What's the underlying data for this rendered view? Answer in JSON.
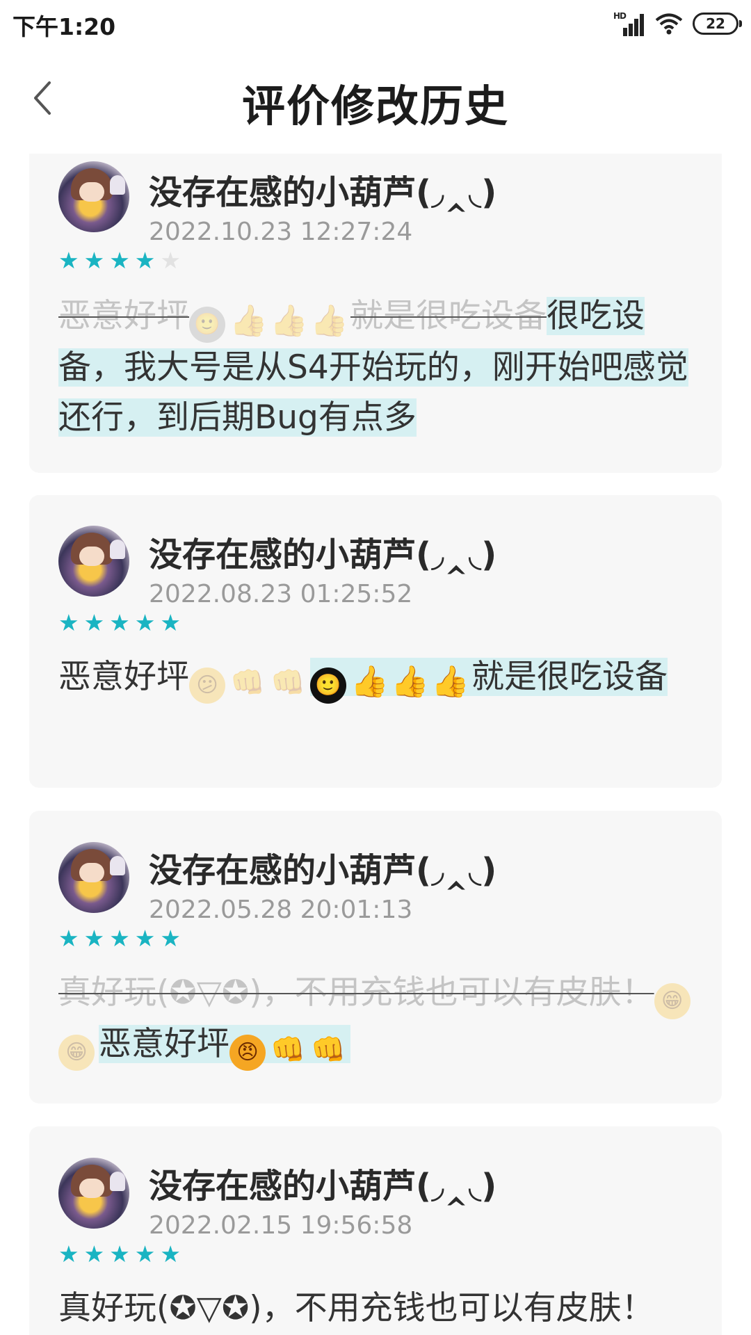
{
  "status_bar": {
    "time": "下午1:20",
    "network": "HD",
    "battery": "22"
  },
  "header": {
    "title": "评价修改历史",
    "back_icon": "chevron-left-icon"
  },
  "reviews": [
    {
      "username": "没存在感的小葫芦(◞‸◟)",
      "timestamp": "2022.10.23 12:27:24",
      "rating": 4,
      "deleted_text": "恶意好坪",
      "deleted_emojis": [
        "🙂",
        "👍",
        "👍",
        "👍"
      ],
      "deleted_text_2": "就是很吃设备",
      "added_text": "很吃设备，我大号是从S4开始玩的，刚开始吧感觉还行，到后期Bug有点多"
    },
    {
      "username": "没存在感的小葫芦(◞‸◟)",
      "timestamp": "2022.08.23 01:25:52",
      "rating": 5,
      "plain_text": "恶意好坪",
      "deleted_emojis": [
        "😕",
        "👊",
        "👊"
      ],
      "added_emojis": [
        "🙂",
        "👍",
        "👍",
        "👍"
      ],
      "added_text": "就是很吃设备"
    },
    {
      "username": "没存在感的小葫芦(◞‸◟)",
      "timestamp": "2022.05.28 20:01:13",
      "rating": 5,
      "deleted_text": "真好玩(✪▽✪)，不用充钱也可以有皮肤！",
      "deleted_emojis": [
        "😁",
        "😁"
      ],
      "added_text": "恶意好坪",
      "added_emojis": [
        "😠",
        "👊",
        "👊"
      ]
    },
    {
      "username": "没存在感的小葫芦(◞‸◟)",
      "timestamp": "2022.02.15 19:56:58",
      "rating": 5,
      "plain_text": "真好玩(✪▽✪)，不用充钱也可以有皮肤！"
    }
  ],
  "colors": {
    "star": "#1ab4c2",
    "added_bg": "#d6f0f2",
    "deleted_text": "#c4c4c4",
    "card_bg": "#f7f7f7"
  }
}
